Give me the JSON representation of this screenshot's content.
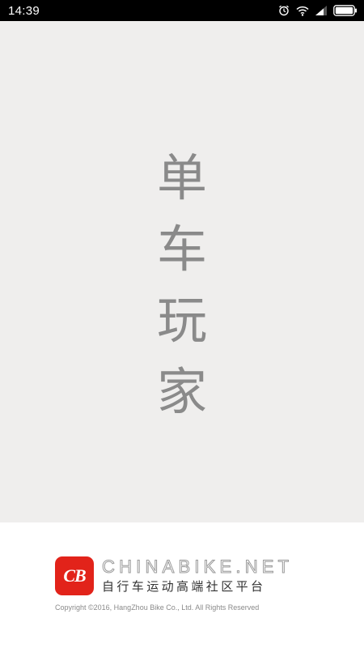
{
  "status_bar": {
    "time": "14:39",
    "icons": [
      "alarm-icon",
      "wifi-icon",
      "signal-icon",
      "battery-icon"
    ]
  },
  "splash": {
    "title_chars": [
      "单",
      "车",
      "玩",
      "家"
    ],
    "background_color": "#efeeed",
    "text_color": "#8a8a8a"
  },
  "footer": {
    "logo_text": "CB",
    "logo_color": "#e2231a",
    "brand_name": "CHINABIKE.NET",
    "slogan": "自行车运动高端社区平台",
    "copyright": "Copyright ©2016, HangZhou Bike Co., Ltd. All Rights Reserved"
  }
}
